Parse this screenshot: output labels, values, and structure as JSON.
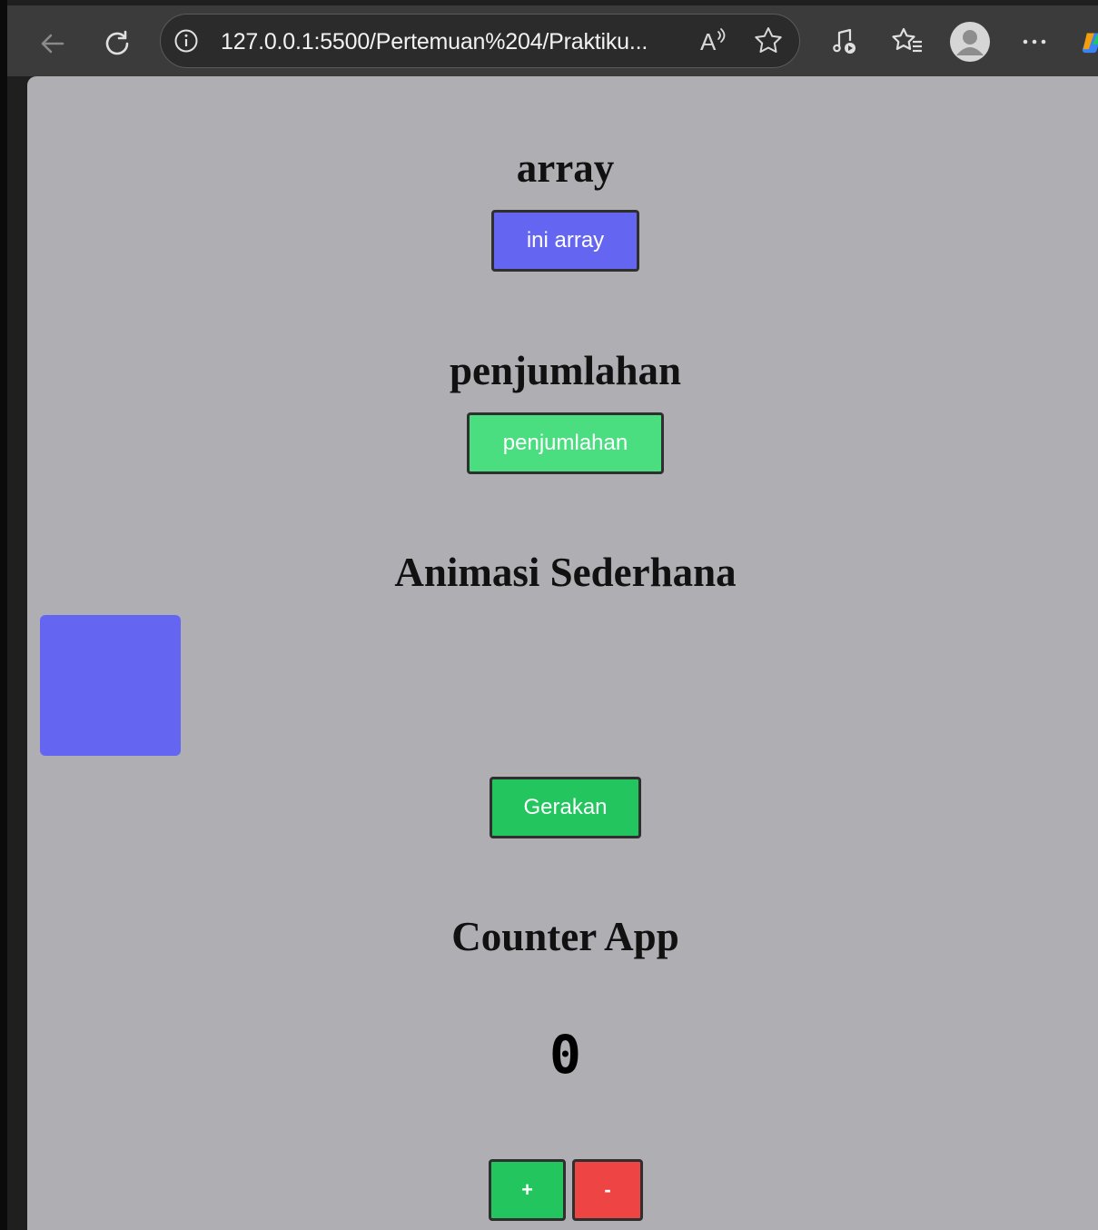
{
  "browser": {
    "url": "127.0.0.1:5500/Pertemuan%204/Praktiku...",
    "icons": {
      "back": "back-arrow-icon",
      "reload": "reload-icon",
      "site_info": "info-icon",
      "read_aloud": "read-aloud-icon",
      "favorite": "star-icon",
      "media": "media-control-icon",
      "favorites": "favorites-list-icon",
      "profile": "profile-avatar-icon",
      "more": "more-options-icon",
      "copilot": "copilot-icon"
    }
  },
  "page": {
    "array_section": {
      "title": "array",
      "button_label": "ini array"
    },
    "sum_section": {
      "title": "penjumlahan",
      "button_label": "penjumlahan"
    },
    "animation_section": {
      "title": "Animasi Sederhana",
      "button_label": "Gerakan"
    },
    "counter_section": {
      "title": "Counter App",
      "value": "0",
      "plus_label": "+",
      "minus_label": "-"
    }
  },
  "colors": {
    "page_background": "#afaeb3",
    "indigo": "#6466f1",
    "light_green": "#4ade80",
    "green": "#22c55e",
    "red": "#ef4444"
  }
}
